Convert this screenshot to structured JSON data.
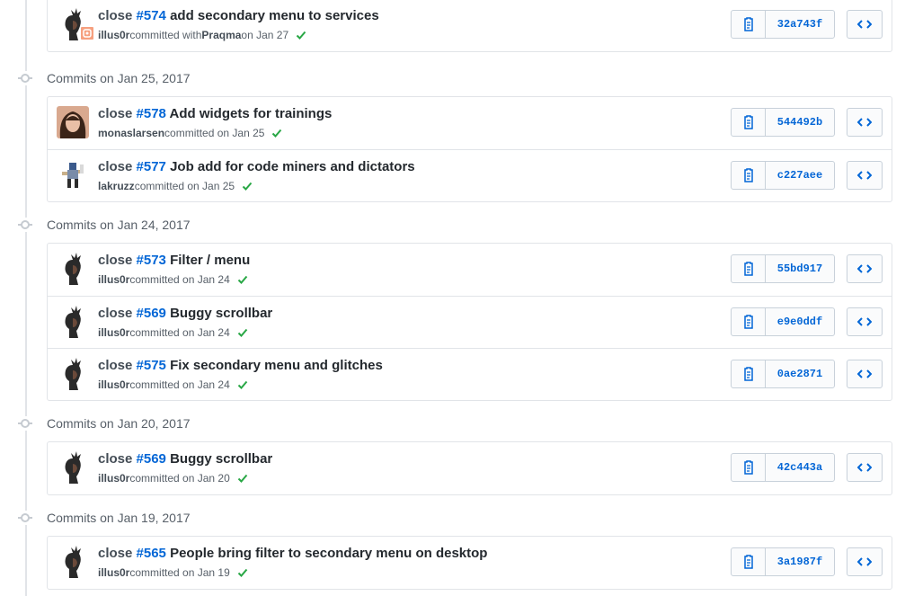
{
  "groups": [
    {
      "header": "",
      "commits": [
        {
          "prefix": "close ",
          "issue": "#574",
          "message": " add secondary menu to services",
          "author": "illus0r",
          "action": " committed with ",
          "coauthor": "Praqma",
          "date": " on Jan 27",
          "sha": "32a743f",
          "avatar": "mohawk-avatar"
        }
      ]
    },
    {
      "header": "Commits on Jan 25, 2017",
      "commits": [
        {
          "prefix": "close ",
          "issue": "#578",
          "message": " Add widgets for trainings",
          "author": "monaslarsen",
          "action": " committed on Jan 25",
          "sha": "544492b",
          "avatar": "woman-avatar"
        },
        {
          "prefix": "close ",
          "issue": "#577",
          "message": " Job add for code miners and dictators",
          "author": "lakruzz",
          "action": " committed on Jan 25",
          "sha": "c227aee",
          "avatar": "pixel-character-avatar"
        }
      ]
    },
    {
      "header": "Commits on Jan 24, 2017",
      "commits": [
        {
          "prefix": "close ",
          "issue": "#573",
          "message": " Filter / menu",
          "author": "illus0r",
          "action": " committed on Jan 24",
          "sha": "55bd917",
          "avatar": "mohawk-avatar"
        },
        {
          "prefix": "close ",
          "issue": "#569",
          "message": " Buggy scrollbar",
          "author": "illus0r",
          "action": " committed on Jan 24",
          "sha": "e9e0ddf",
          "avatar": "mohawk-avatar"
        },
        {
          "prefix": "close ",
          "issue": "#575",
          "message": " Fix secondary menu and glitches",
          "author": "illus0r",
          "action": " committed on Jan 24",
          "sha": "0ae2871",
          "avatar": "mohawk-avatar"
        }
      ]
    },
    {
      "header": "Commits on Jan 20, 2017",
      "commits": [
        {
          "prefix": "close ",
          "issue": "#569",
          "message": " Buggy scrollbar",
          "author": "illus0r",
          "action": " committed on Jan 20",
          "sha": "42c443a",
          "avatar": "mohawk-avatar"
        }
      ]
    },
    {
      "header": "Commits on Jan 19, 2017",
      "commits": [
        {
          "prefix": "close ",
          "issue": "#565",
          "message": " People bring filter to secondary menu on desktop",
          "author": "illus0r",
          "action": " committed on Jan 19",
          "sha": "3a1987f",
          "avatar": "mohawk-avatar"
        }
      ]
    }
  ],
  "colors": {
    "link": "#0366d6",
    "success": "#28a745",
    "border": "#e1e4e8"
  },
  "icons": {
    "status": "check-icon",
    "copy": "clipboard-icon",
    "browse": "code-brackets-icon"
  }
}
